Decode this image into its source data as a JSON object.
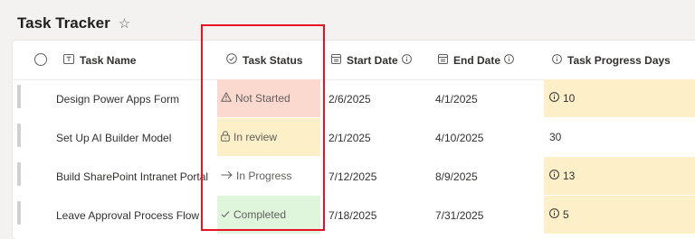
{
  "page": {
    "title": "Task Tracker",
    "favorite_icon": "star-outline-icon"
  },
  "columns": [
    {
      "label": "Task Name",
      "icon": "text-field-icon"
    },
    {
      "label": "Task Status",
      "icon": "circle-check-icon"
    },
    {
      "label": "Start Date",
      "icon": "calendar-icon",
      "info_icon": "info-icon"
    },
    {
      "label": "End Date",
      "icon": "calendar-icon",
      "info_icon": "info-icon"
    },
    {
      "label": "Task Progress Days",
      "icon": "info-icon"
    }
  ],
  "rows": [
    {
      "task": "Design Power Apps Form",
      "status": "Not Started",
      "status_icon": "warning-icon",
      "status_color": "#fcd9cf",
      "start": "2/6/2025",
      "end": "4/1/2025",
      "days": "10",
      "days_icon": "info-icon",
      "days_color": "#fdf0c9"
    },
    {
      "task": "Set Up AI Builder Model",
      "status": "In review",
      "status_icon": "lock-icon",
      "status_color": "#fdf0c9",
      "start": "2/1/2025",
      "end": "4/10/2025",
      "days": "30",
      "days_icon": "",
      "days_color": "#ffffff"
    },
    {
      "task": "Build SharePoint Intranet Portal",
      "status": "In Progress",
      "status_icon": "arrow-right-icon",
      "status_color": "#ffffff",
      "start": "7/12/2025",
      "end": "8/9/2025",
      "days": "13",
      "days_icon": "info-icon",
      "days_color": "#fdf0c9"
    },
    {
      "task": "Leave Approval Process Flow",
      "status": "Completed",
      "status_icon": "checkmark-icon",
      "status_color": "#dff6dd",
      "start": "7/18/2025",
      "end": "7/31/2025",
      "days": "5",
      "days_icon": "info-icon",
      "days_color": "#fdf0c9"
    }
  ],
  "highlight_color": "#e81123"
}
